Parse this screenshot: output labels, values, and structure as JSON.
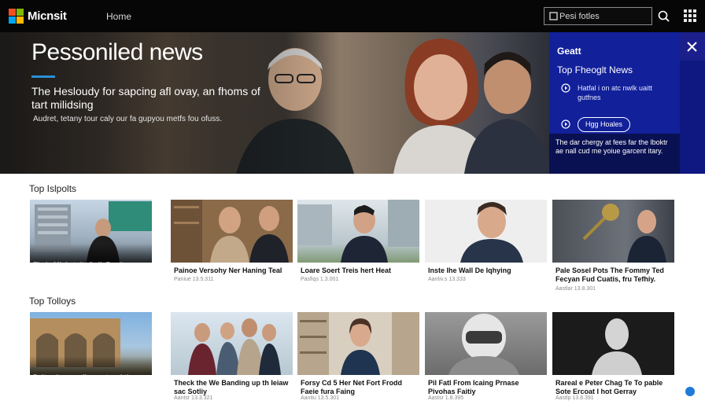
{
  "header": {
    "brand": "Micnsit",
    "nav_home": "Home",
    "search_placeholder": "Pesi fotles",
    "logo_colors": [
      "#f25022",
      "#7fba00",
      "#00a4ef",
      "#ffb900"
    ]
  },
  "hero": {
    "title": "Pessoniled news",
    "subtitle": "The Hesloudy for sapcing afl ovay, an fhoms of tart milidsing",
    "description": "Audret, tetany tour caly our fa gupyou metfs fou ofuss."
  },
  "side_panel": {
    "heading": "Geatt",
    "top_label": "Top Fheoglt News",
    "item1": "Hatfal i on atc nwlk uaitt gutfnes",
    "button": "Hgg Hoales",
    "footer": "The dar chergy at fees far the lboktr ae nall cud me yoiue garcent itary."
  },
  "sections": [
    {
      "title": "Top Islpolts",
      "cards": [
        {
          "headline": "Fiede Miale tolt, Golk Renites Ireche Wens",
          "meta": "",
          "overlay": true,
          "image": "building-woman"
        },
        {
          "headline": "Painoe Versohy Ner Haning Teal",
          "meta": "Paniue 13.5.311",
          "overlay": false,
          "image": "two-men"
        },
        {
          "headline": "Loare Soert Treis hert Heat",
          "meta": "Pasfiqs 1.3.001",
          "overlay": false,
          "image": "man-suit"
        },
        {
          "headline": "Inste Ihe Wall De Iqhying",
          "meta": "Aantiv.s 13.333",
          "overlay": false,
          "image": "portrait"
        },
        {
          "headline": "Pale Sosel Pots The Fommy Ted Fecyan Fud Cuatis, fru Tefhiy.",
          "meta": "Aastlar 13.8.301",
          "overlay": false,
          "image": "award"
        }
      ]
    },
    {
      "title": "Top Tolloys",
      "cards": [
        {
          "headline": "Pelt enlan samlinpraet vad the coetes Fron onpih ertlord",
          "meta": "",
          "overlay": true,
          "image": "arches"
        },
        {
          "headline": "Theck the We Banding up th Ieiaw sac Sotliy",
          "meta": "Aantsr 13.3.321",
          "overlay": false,
          "image": "group"
        },
        {
          "headline": "Forsy Cd 5 Her Net Fort Frodd Faeie fura Faing",
          "meta": "Aantiu 13.5.301",
          "overlay": false,
          "image": "bookshelf"
        },
        {
          "headline": "Pil Fatl From Icaing Prnase Pivohas Faitiy",
          "meta": "Aastsr 1.8.395",
          "overlay": false,
          "image": "helmet"
        },
        {
          "headline": "Rareal e Peter Chag Te To pable Sote Ercoat I hot Gerray",
          "meta": "Aastlp 13.8.391",
          "overlay": false,
          "image": "statue"
        }
      ]
    }
  ]
}
